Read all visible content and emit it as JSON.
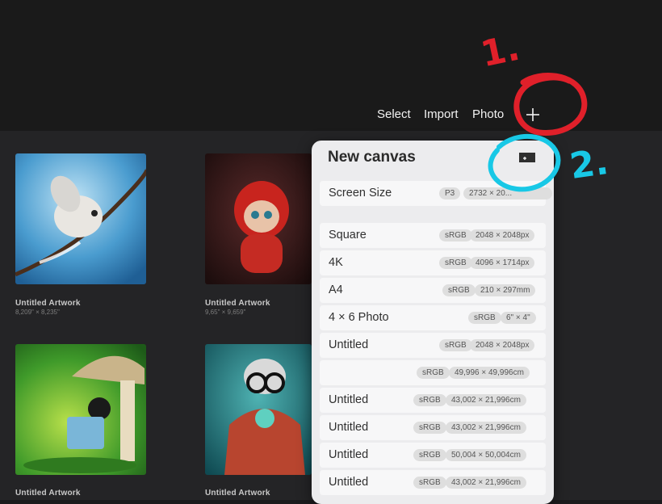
{
  "toolbar": {
    "select_label": "Select",
    "import_label": "Import",
    "photo_label": "Photo"
  },
  "gallery": [
    {
      "title": "Untitled Artwork",
      "dims": "8,209\" × 8,235\""
    },
    {
      "title": "Untitled Artwork",
      "dims": "9,65\" × 9,659\""
    },
    {
      "title": "Untitled Artwork",
      "dims": ""
    },
    {
      "title": "Untitled Artwork",
      "dims": ""
    }
  ],
  "new_canvas": {
    "title": "New canvas",
    "screen_size": {
      "label": "Screen Size",
      "color_space": "P3",
      "size": "2732 × 20..."
    },
    "presets": [
      {
        "label": "Square",
        "color_space": "sRGB",
        "size": "2048 × 2048px"
      },
      {
        "label": "4K",
        "color_space": "sRGB",
        "size": "4096 × 1714px"
      },
      {
        "label": "A4",
        "color_space": "sRGB",
        "size": "210 × 297mm"
      },
      {
        "label": "4 × 6 Photo",
        "color_space": "sRGB",
        "size": "6\" × 4\""
      },
      {
        "label": "Untitled",
        "color_space": "sRGB",
        "size": "2048 × 2048px"
      },
      {
        "label": "",
        "color_space": "sRGB",
        "size": "49,996 × 49,996cm"
      },
      {
        "label": "Untitled",
        "color_space": "sRGB",
        "size": "43,002 × 21,996cm"
      },
      {
        "label": "Untitled",
        "color_space": "sRGB",
        "size": "43,002 × 21,996cm"
      },
      {
        "label": "Untitled",
        "color_space": "sRGB",
        "size": "50,004 × 50,004cm"
      },
      {
        "label": "Untitled",
        "color_space": "sRGB",
        "size": "43,002 × 21,996cm"
      }
    ]
  },
  "annotations": {
    "step1": "1.",
    "step2": "2.",
    "step1_color": "#e0202a",
    "step2_color": "#18c8e6"
  },
  "icons": {
    "plus": "plus-icon",
    "new_folder": "folder-plus-icon"
  }
}
